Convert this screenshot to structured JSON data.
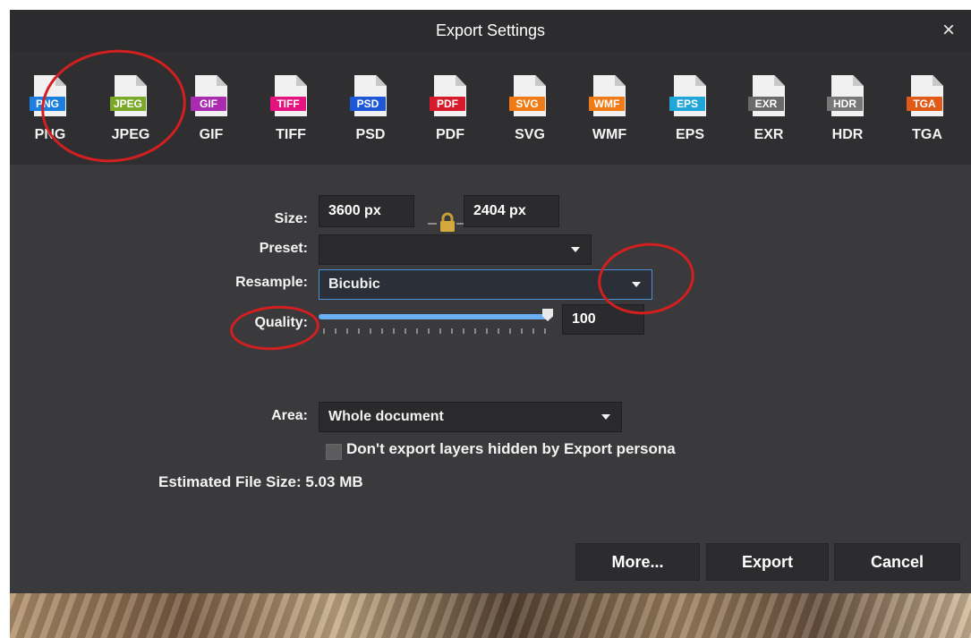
{
  "dialog": {
    "title": "Export Settings",
    "close_symbol": "×"
  },
  "formats": [
    {
      "name": "PNG",
      "tag": "PNG",
      "color": "#1c7fe0",
      "selected": false
    },
    {
      "name": "JPEG",
      "tag": "JPEG",
      "color": "#7aa829",
      "selected": true
    },
    {
      "name": "GIF",
      "tag": "GIF",
      "color": "#a82bb0",
      "selected": false
    },
    {
      "name": "TIFF",
      "tag": "TIFF",
      "color": "#e4137d",
      "selected": false
    },
    {
      "name": "PSD",
      "tag": "PSD",
      "color": "#1e57d7",
      "selected": false
    },
    {
      "name": "PDF",
      "tag": "PDF",
      "color": "#d81b2c",
      "selected": false
    },
    {
      "name": "SVG",
      "tag": "SVG",
      "color": "#f07b16",
      "selected": false
    },
    {
      "name": "WMF",
      "tag": "WMF",
      "color": "#f07b16",
      "selected": false
    },
    {
      "name": "EPS",
      "tag": "EPS",
      "color": "#20a6d8",
      "selected": false
    },
    {
      "name": "EXR",
      "tag": "EXR",
      "color": "#6a6a6a",
      "selected": false
    },
    {
      "name": "HDR",
      "tag": "HDR",
      "color": "#777777",
      "selected": false
    },
    {
      "name": "TGA",
      "tag": "TGA",
      "color": "#e25a18",
      "selected": false
    }
  ],
  "settings": {
    "size_label": "Size:",
    "width": "3600 px",
    "height": "2404 px",
    "preset_label": "Preset:",
    "preset_value": "",
    "resample_label": "Resample:",
    "resample_value": "Bicubic",
    "quality_label": "Quality:",
    "quality_value": "100",
    "quality_fraction": 1.0,
    "area_label": "Area:",
    "area_value": "Whole document",
    "hidden_layers_label": "Don't export layers hidden by Export persona",
    "estimated_file_size": "Estimated File Size: 5.03 MB"
  },
  "buttons": {
    "more": "More...",
    "export": "Export",
    "cancel": "Cancel"
  },
  "colors": {
    "accent": "#4b8fd8",
    "annotation": "#d31f1f",
    "dialog_background": "#3a3a3c"
  }
}
